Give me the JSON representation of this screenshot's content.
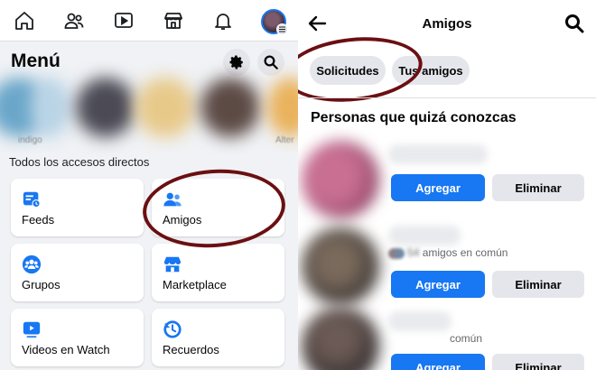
{
  "left": {
    "nav": {
      "icons": [
        "home-icon",
        "friends-icon",
        "watch-icon",
        "marketplace-icon",
        "notifications-icon",
        "profile-avatar"
      ]
    },
    "menu_title": "Menú",
    "stories": {
      "labels": [
        "indigo",
        "Alter"
      ]
    },
    "section_title": "Todos los accesos directos",
    "shortcuts": [
      {
        "label": "Feeds",
        "icon": "feeds-icon",
        "highlighted": false
      },
      {
        "label": "Amigos",
        "icon": "friends-icon",
        "highlighted": true
      },
      {
        "label": "Grupos",
        "icon": "groups-icon",
        "highlighted": false
      },
      {
        "label": "Marketplace",
        "icon": "marketplace-icon",
        "highlighted": false
      },
      {
        "label": "Videos en Watch",
        "icon": "watch-icon",
        "highlighted": false
      },
      {
        "label": "Recuerdos",
        "icon": "memories-icon",
        "highlighted": false
      }
    ]
  },
  "right": {
    "title": "Amigos",
    "chips": [
      {
        "label": "Solicitudes",
        "highlighted": true
      },
      {
        "label": "Tus amigos",
        "highlighted": false
      }
    ],
    "suggestions_title": "Personas que quizá conozcas",
    "people": [
      {
        "mutual": ""
      },
      {
        "mutual_prefix": "54",
        "mutual_suffix": "amigos en común"
      },
      {
        "mutual_prefix": "",
        "mutual_suffix": "común"
      }
    ],
    "add_label": "Agregar",
    "remove_label": "Eliminar"
  },
  "colors": {
    "brand_blue": "#1877f2",
    "annotation_ring": "#6b0f12",
    "panel_bg": "#f0f2f5"
  }
}
